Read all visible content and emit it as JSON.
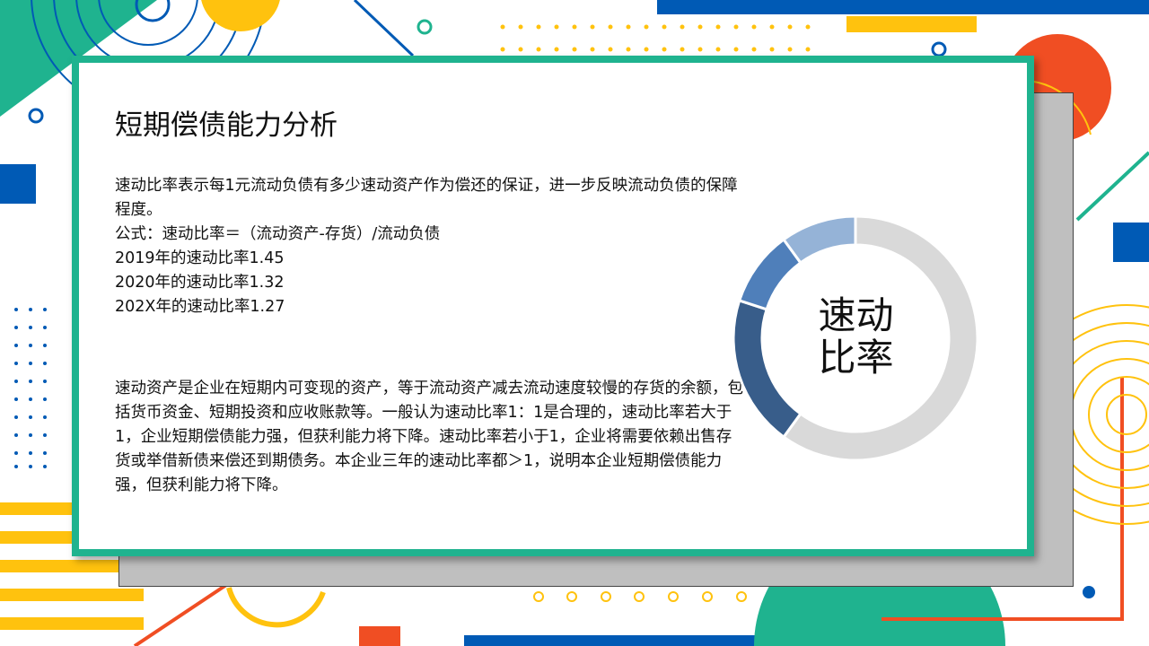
{
  "slide": {
    "title": "短期偿债能力分析",
    "lines": [
      "速动比率表示每1元流动负债有多少速动资产作为偿还的保证，进一步反映流动负债的保障程度。",
      "公式：速动比率＝（流动资产-存货）/流动负债",
      "2019年的速动比率1.45",
      "2020年的速动比率1.32",
      "202X年的速动比率1.27"
    ],
    "paragraph": "速动资产是企业在短期内可变现的资产，等于流动资产减去流动速度较慢的存货的余额，包括货币资金、短期投资和应收账款等。一般认为速动比率1：1是合理的，速动比率若大于1，企业短期偿债能力强，但获利能力将下降。速动比率若小于1，企业将需要依赖出售存货或举借新债来偿还到期债务。本企业三年的速动比率都＞1，说明本企业短期偿债能力强，但获利能力将下降。",
    "donut_label_line1": "速动",
    "donut_label_line2": "比率"
  },
  "donut": {
    "segments": [
      {
        "value": 60,
        "color": "#d9d9d9"
      },
      {
        "value": 20,
        "color": "#385d8a"
      },
      {
        "value": 10,
        "color": "#4f7fba"
      },
      {
        "value": 10,
        "color": "#95b3d7"
      }
    ]
  },
  "colors": {
    "accent_green": "#1fb38f",
    "yellow": "#ffc20e",
    "blue": "#005ab5",
    "orange_red": "#f04e23"
  }
}
